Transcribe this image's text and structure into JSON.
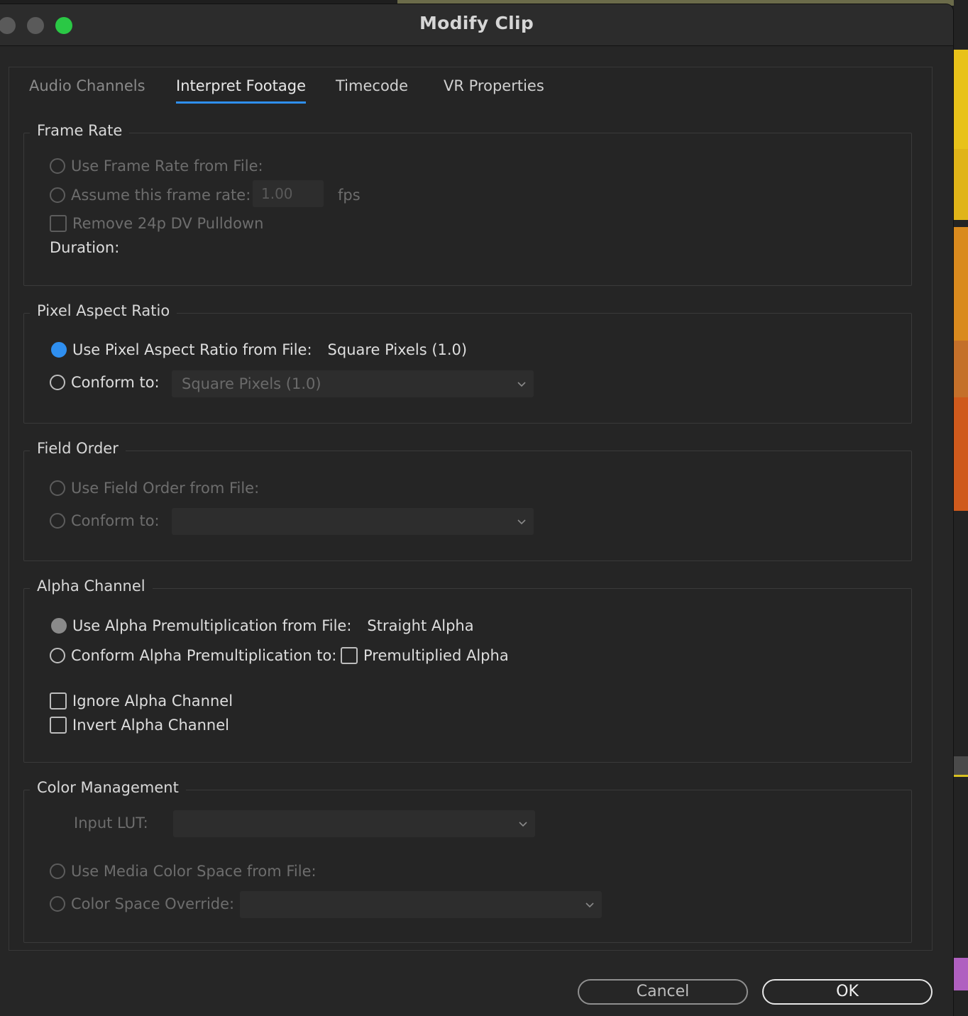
{
  "window": {
    "title": "Modify Clip"
  },
  "tabs": [
    {
      "label": "Audio Channels",
      "state": "disabled"
    },
    {
      "label": "Interpret Footage",
      "state": "active"
    },
    {
      "label": "Timecode",
      "state": "enabled"
    },
    {
      "label": "VR Properties",
      "state": "enabled"
    }
  ],
  "frame_rate": {
    "legend": "Frame Rate",
    "use_from_file": "Use Frame Rate from File:",
    "assume": "Assume this frame rate:",
    "assume_value": "1.00",
    "fps_unit": "fps",
    "remove_pulldown": "Remove 24p DV Pulldown",
    "duration_label": "Duration:"
  },
  "pixel_aspect": {
    "legend": "Pixel Aspect Ratio",
    "use_from_file": "Use Pixel Aspect Ratio from File:",
    "file_value": "Square Pixels (1.0)",
    "conform_to": "Conform to:",
    "conform_value": "Square Pixels (1.0)"
  },
  "field_order": {
    "legend": "Field Order",
    "use_from_file": "Use Field Order from File:",
    "conform_to": "Conform to:",
    "conform_value": ""
  },
  "alpha": {
    "legend": "Alpha Channel",
    "use_from_file": "Use Alpha Premultiplication from File:",
    "file_value": "Straight Alpha",
    "conform": "Conform Alpha Premultiplication to:",
    "premultiplied": "Premultiplied Alpha",
    "ignore": "Ignore Alpha Channel",
    "invert": "Invert Alpha Channel"
  },
  "color": {
    "legend": "Color Management",
    "input_lut": "Input LUT:",
    "input_lut_value": "",
    "use_media": "Use Media Color Space from File:",
    "override": "Color Space Override:",
    "override_value": ""
  },
  "buttons": {
    "cancel": "Cancel",
    "ok": "OK"
  },
  "colors": {
    "accent": "#2f8ff0",
    "maximize": "#2ac845"
  }
}
